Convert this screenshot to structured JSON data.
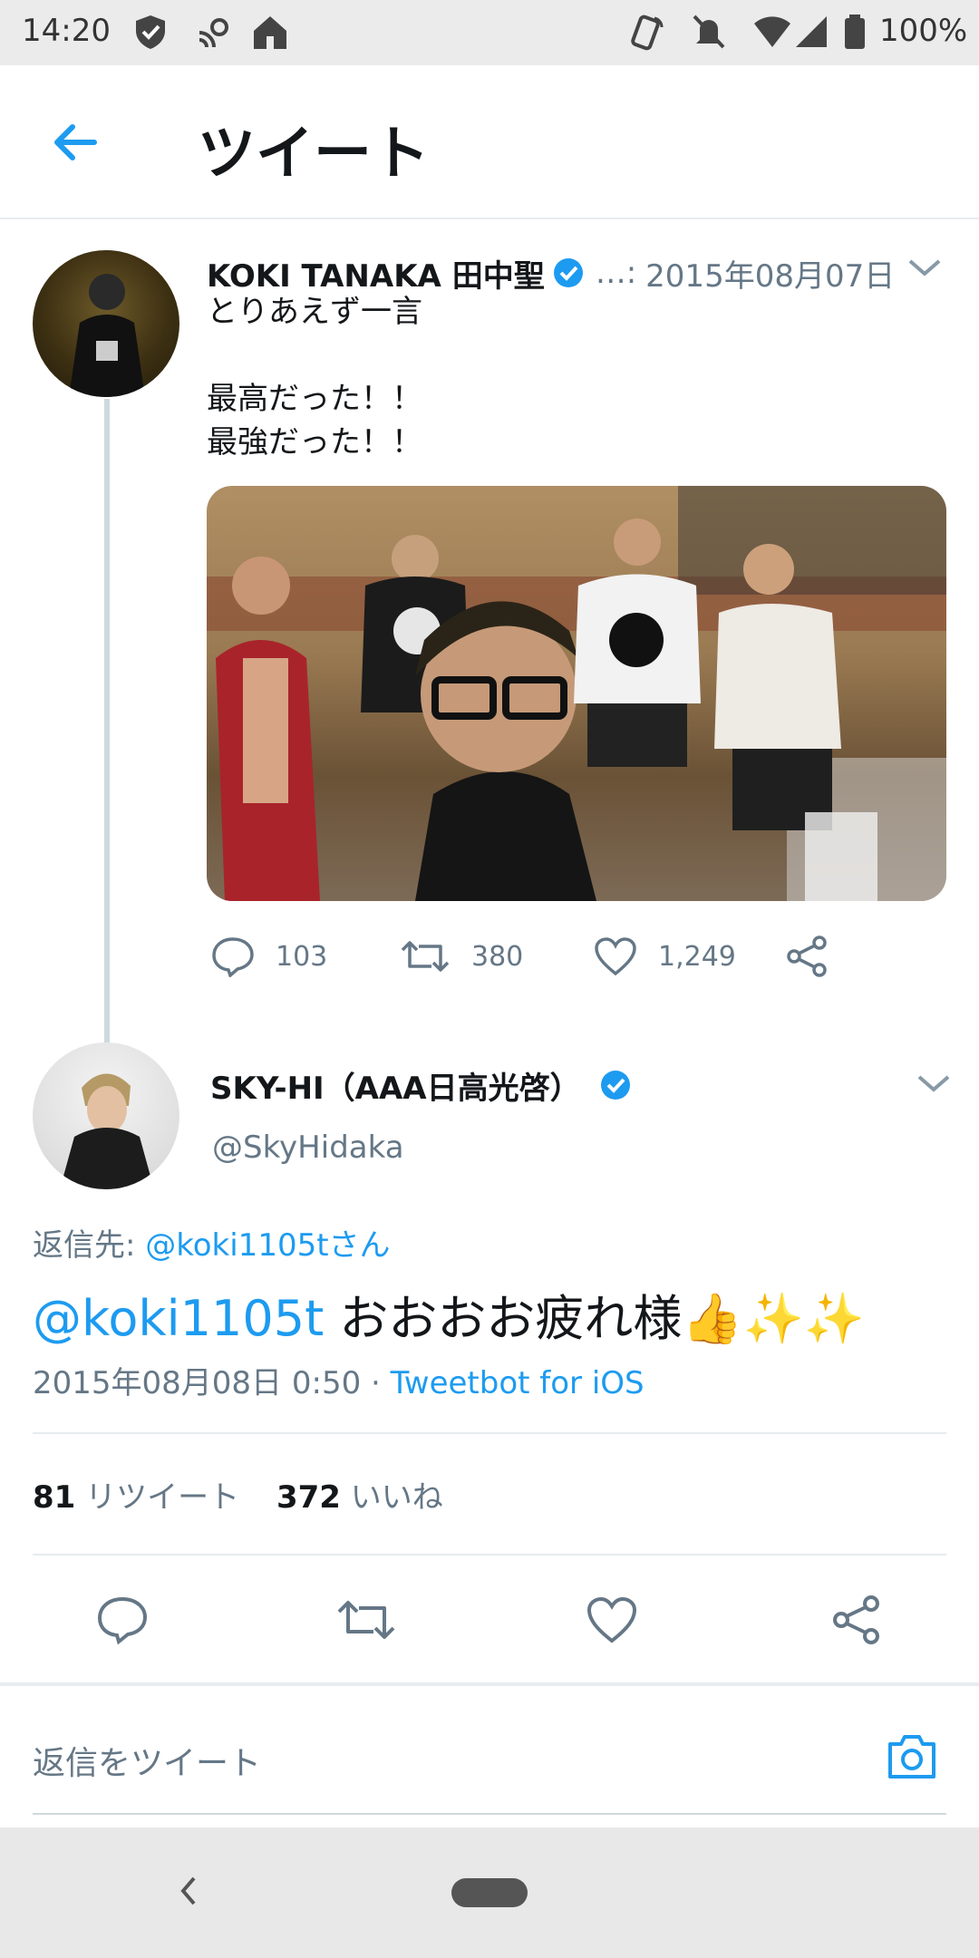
{
  "status_bar": {
    "time": "14:20",
    "battery": "100%",
    "icons_left": [
      "shield-icon",
      "cast-icon",
      "home-icon"
    ],
    "icons_right": [
      "nfc-icon",
      "mute-icon",
      "wifi-icon",
      "signal-icon",
      "battery-icon"
    ]
  },
  "header": {
    "title": "ツイート",
    "back_icon": "arrow-left-icon"
  },
  "parent_tweet": {
    "name": "KOKI TANAKA 田中聖",
    "handle_trunc": "…:",
    "date": "2015年08月07日",
    "text": "とりあえず一言\n\n最高だった！！\n最強だった！！",
    "replies": "103",
    "retweets": "380",
    "likes": "1,249"
  },
  "reply_tweet": {
    "name": "SKY-HI（AAA日高光啓）",
    "handle": "@SkyHidaka",
    "reply_to_prefix": "返信先: ",
    "reply_to_handle": "@koki1105tさん",
    "mention": "@koki1105t",
    "text": " おおおお疲れ様👍✨✨",
    "timestamp": "2015年08月08日 0:50 · ",
    "source": "Tweetbot for iOS",
    "retweet_count": "81",
    "retweet_label": "リツイート",
    "like_count": "372",
    "like_label": "いいね"
  },
  "compose": {
    "placeholder": "返信をツイート"
  },
  "colors": {
    "accent": "#1d9bf0",
    "secondary_text": "#657786",
    "divider": "#e6ecf0",
    "status_bar_bg": "#ebebec"
  }
}
